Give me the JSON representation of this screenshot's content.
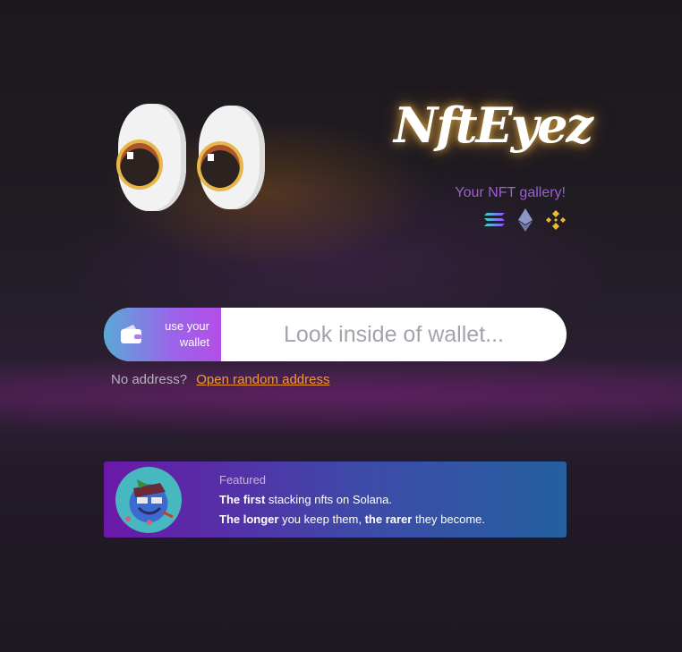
{
  "brand": {
    "logo_text": "NftEyez",
    "tagline": "Your NFT gallery!",
    "chains": [
      {
        "name": "solana-icon",
        "color": "#9945ff"
      },
      {
        "name": "ethereum-icon",
        "color": "#8c96c8"
      },
      {
        "name": "binance-icon",
        "color": "#f3ba2f"
      }
    ]
  },
  "search": {
    "wallet_button_line1": "use your",
    "wallet_button_line2": "wallet",
    "placeholder": "Look inside of wallet..."
  },
  "random": {
    "prompt": "No address?",
    "link": "Open random address"
  },
  "featured": {
    "label": "Featured",
    "line1_bold": "The first",
    "line1_rest": "stacking nfts on Solana.",
    "line2_bold1": "The longer",
    "line2_mid": "you keep them,",
    "line2_bold2": "the rarer",
    "line2_end": "they become."
  },
  "colors": {
    "accent_orange": "#f09a2c",
    "tagline_purple": "#9b5fd0"
  }
}
